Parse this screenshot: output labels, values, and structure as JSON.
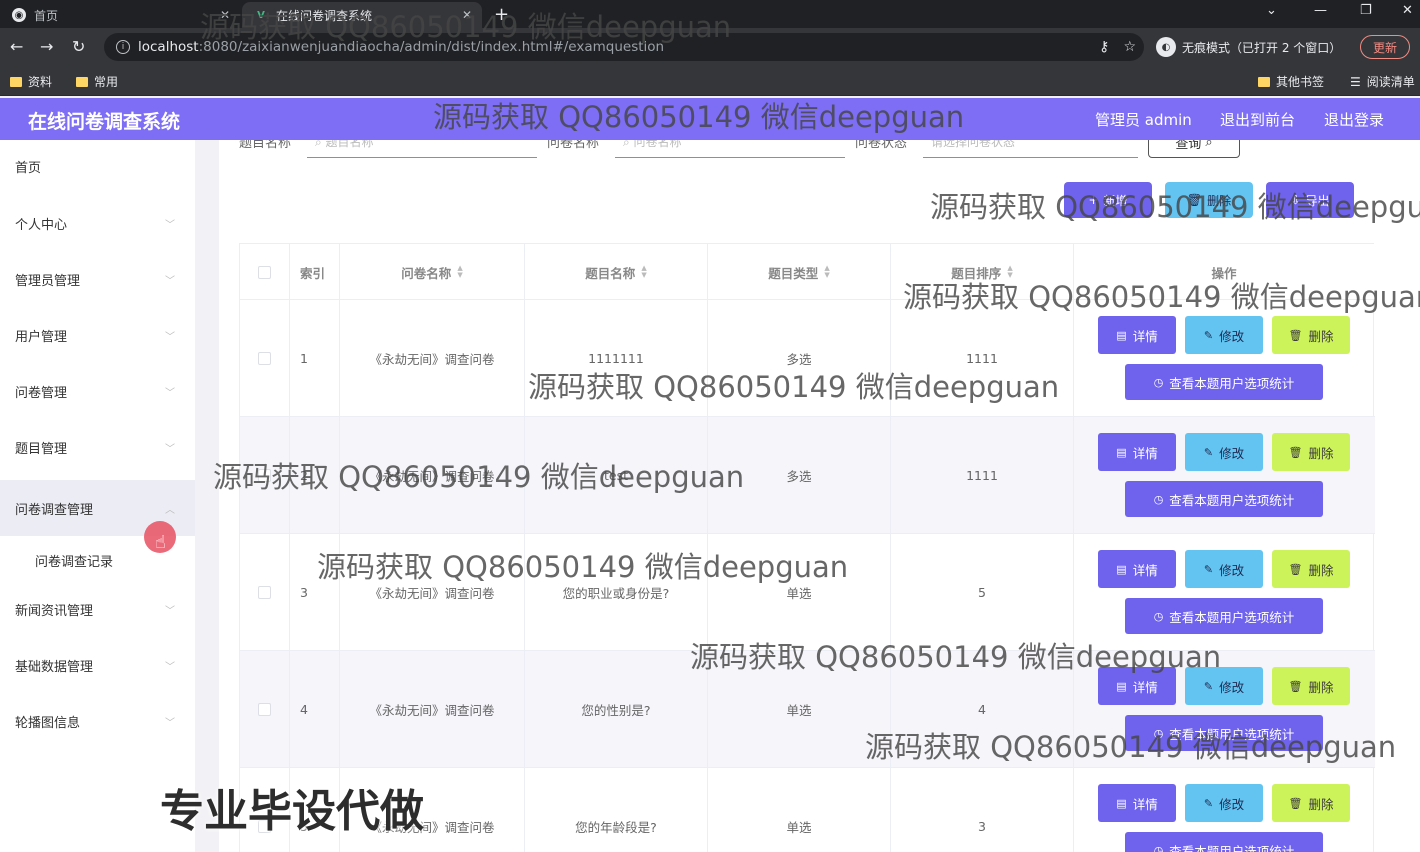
{
  "browser": {
    "tabs": [
      {
        "title": "首页"
      },
      {
        "title": "在线问卷调查系统"
      }
    ],
    "new_tab": "+",
    "url_host": "localhost",
    "url_path": ":8080/zaixianwenjuandiaocha/admin/dist/index.html#/examquestion",
    "incognito": "无痕模式（已打开 2 个窗口）",
    "update_label": "更新",
    "bookmarks": [
      "资料",
      "常用"
    ],
    "bookmarks_right": [
      "其他书签",
      "阅读清单"
    ]
  },
  "header": {
    "title": "在线问卷调查系统",
    "user_label": "管理员 admin",
    "to_front": "退出到前台",
    "logout": "退出登录"
  },
  "sidebar": {
    "items": [
      {
        "label": "首页"
      },
      {
        "label": "个人中心"
      },
      {
        "label": "管理员管理"
      },
      {
        "label": "用户管理"
      },
      {
        "label": "问卷管理"
      },
      {
        "label": "题目管理"
      },
      {
        "label": "问卷调查管理"
      },
      {
        "label": "新闻资讯管理"
      },
      {
        "label": "基础数据管理"
      },
      {
        "label": "轮播图信息"
      }
    ],
    "subitem": "问卷调查记录"
  },
  "search": {
    "labels": [
      "题目名称",
      "问卷名称",
      "问卷状态"
    ],
    "placeholders": [
      "题目名称",
      "问卷名称",
      "请选择问卷状态"
    ],
    "query_button": "查询"
  },
  "actions": {
    "add": "新增",
    "delete": "删除",
    "export": "导出"
  },
  "table": {
    "columns": [
      "索引",
      "问卷名称",
      "题目名称",
      "题目类型",
      "题目排序",
      "操作"
    ],
    "rows": [
      {
        "index": "1",
        "questionnaire": "《永劫无间》调查问卷",
        "question": "1111111",
        "type": "多选",
        "order": "1111"
      },
      {
        "index": "2",
        "questionnaire": "《永劫无间》调查问卷",
        "question": "test",
        "type": "多选",
        "order": "1111"
      },
      {
        "index": "3",
        "questionnaire": "《永劫无间》调查问卷",
        "question": "您的职业或身份是?",
        "type": "单选",
        "order": "5"
      },
      {
        "index": "4",
        "questionnaire": "《永劫无间》调查问卷",
        "question": "您的性别是?",
        "type": "单选",
        "order": "4"
      },
      {
        "index": "5",
        "questionnaire": "《永劫无间》调查问卷",
        "question": "您的年龄段是?",
        "type": "单选",
        "order": "3"
      }
    ],
    "btn_detail": "详情",
    "btn_edit": "修改",
    "btn_delete": "删除",
    "btn_stats": "查看本题用户选项统计"
  },
  "watermarks": {
    "text": "源码获取 QQ86050149 微信deepguan",
    "promo": "专业毕设代做"
  },
  "colors": {
    "header": "#7d6ef5",
    "primary": "#6f63ee",
    "edit": "#63c4f2",
    "delete": "#cdf35a"
  }
}
